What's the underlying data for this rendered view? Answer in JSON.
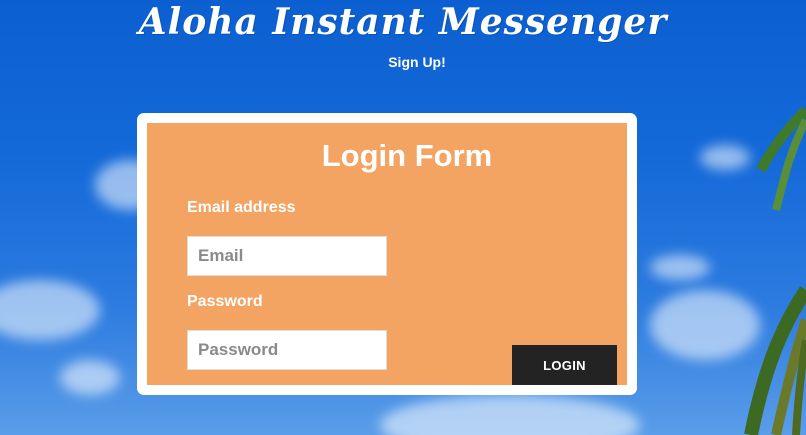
{
  "header": {
    "title": "Aloha Instant Messenger",
    "signup_link": "Sign Up!"
  },
  "form": {
    "title": "Login Form",
    "email_label": "Email address",
    "email_placeholder": "Email",
    "email_value": "",
    "password_label": "Password",
    "password_placeholder": "Password",
    "password_value": "",
    "login_button": "LOGIN"
  },
  "colors": {
    "background_sky": "#1469d8",
    "card_border": "#ffffff",
    "form_panel": "#f3a462",
    "button": "#232323",
    "text": "#ffffff"
  }
}
